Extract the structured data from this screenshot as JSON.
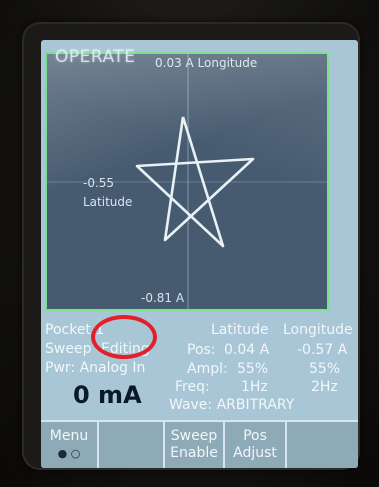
{
  "screen": {
    "title": "OPERATE"
  },
  "plot": {
    "top_label": "0.03 A Longitude",
    "left_value": "-0.55",
    "left_axis": "Latitude",
    "bottom_label": "-0.81 A",
    "trace_color": "#e8f1f6",
    "grid_color": "#7de08c"
  },
  "status": {
    "pocket": "Pocket 1",
    "sweep_label": "Sweep",
    "sweep_value": "Editing",
    "pwr": "Pwr: Analog In",
    "current": "0 mA"
  },
  "params": {
    "col_latitude": "Latitude",
    "col_longitude": "Longitude",
    "pos_label": "Pos:",
    "pos_lat": "0.04 A",
    "pos_long": "-0.57 A",
    "ampl_label": "Ampl:",
    "ampl_lat": "55%",
    "ampl_long": "55%",
    "freq_label": "Freq:",
    "freq_lat": "1Hz",
    "freq_long": "2Hz",
    "wave": "Wave: ARBITRARY"
  },
  "softkeys": {
    "menu": "Menu",
    "menu_dots": "● ○",
    "sweep_enable_1": "Sweep",
    "sweep_enable_2": "Enable",
    "pos_adjust_1": "Pos",
    "pos_adjust_2": "Adjust"
  },
  "annotation": {
    "circle_color": "#e3202a"
  }
}
